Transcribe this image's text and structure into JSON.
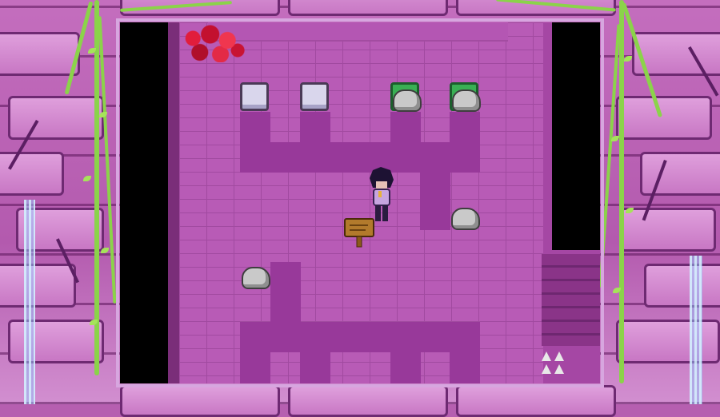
{
  "scene": {
    "name": "brick-room-puzzle",
    "colors": {
      "floor": "#b85bb6",
      "path": "#98399a",
      "wall": "#a547a4",
      "void": "#000000",
      "switch_idle": "#d9d6ec",
      "switch_active": "#39b054",
      "rock": "#c9c9c9",
      "bush": "#e11d3c",
      "vine": "#8bd34a"
    },
    "switches": [
      {
        "id": "switch-1",
        "state": "idle"
      },
      {
        "id": "switch-2",
        "state": "idle"
      },
      {
        "id": "switch-3",
        "state": "pressed-by-rock"
      },
      {
        "id": "switch-4",
        "state": "pressed-by-rock"
      }
    ],
    "rocks_free": 2,
    "icons": [
      "player-sprite",
      "wooden-sign-icon",
      "rock-icon",
      "switch-plate-icon",
      "spike-trap-icon",
      "red-bush-icon"
    ]
  }
}
